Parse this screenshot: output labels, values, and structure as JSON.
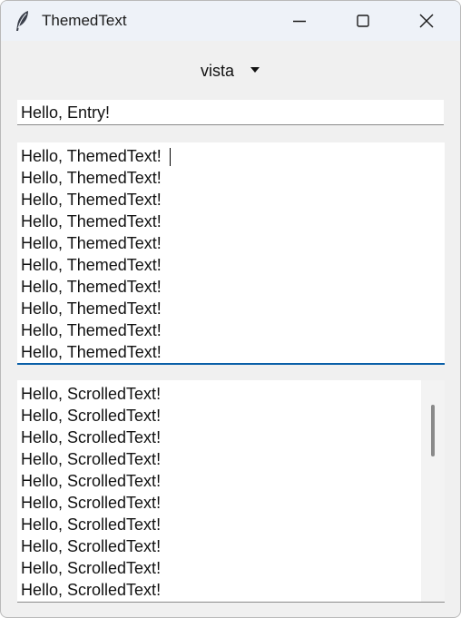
{
  "window": {
    "title": "ThemedText",
    "icon": "feather-icon"
  },
  "caption_buttons": {
    "minimize": "minimize-icon",
    "maximize": "maximize-icon",
    "close": "close-icon"
  },
  "theme_select": {
    "value": "vista",
    "icon": "chevron-down-icon"
  },
  "entry": {
    "value": "Hello, Entry!"
  },
  "themed_text": {
    "lines": [
      "Hello, ThemedText!",
      "Hello, ThemedText!",
      "Hello, ThemedText!",
      "Hello, ThemedText!",
      "Hello, ThemedText!",
      "Hello, ThemedText!",
      "Hello, ThemedText!",
      "Hello, ThemedText!",
      "Hello, ThemedText!",
      "Hello, ThemedText!"
    ]
  },
  "scrolled_text": {
    "lines": [
      "Hello, ScrolledText!",
      "Hello, ScrolledText!",
      "Hello, ScrolledText!",
      "Hello, ScrolledText!",
      "Hello, ScrolledText!",
      "Hello, ScrolledText!",
      "Hello, ScrolledText!",
      "Hello, ScrolledText!",
      "Hello, ScrolledText!",
      "Hello, ScrolledText!"
    ]
  },
  "colors": {
    "window_bg": "#f0f0f0",
    "titlebar_bg": "#eef2f8",
    "focus_accent": "#0a5fa8"
  }
}
